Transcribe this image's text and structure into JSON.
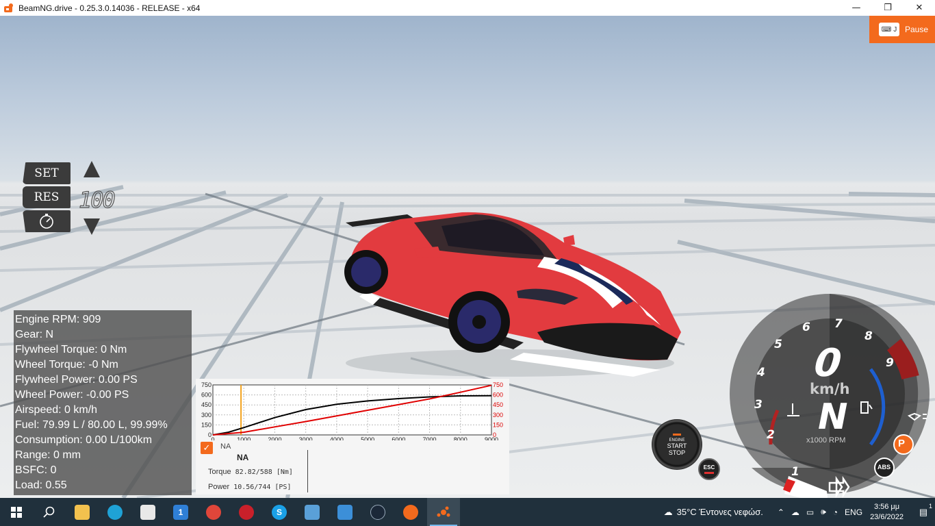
{
  "window": {
    "title": "BeamNG.drive - 0.25.3.0.14036 - RELEASE - x64",
    "minimize": "—",
    "restore": "❐",
    "close": "✕"
  },
  "pause": {
    "key": "J",
    "label": "Pause"
  },
  "cruise": {
    "set": "SET",
    "res": "RES",
    "speed": "100"
  },
  "stats": {
    "lines": [
      "Engine RPM: 909",
      "Gear: N",
      "Flywheel Torque: 0 Nm",
      "Wheel Torque: -0 Nm",
      "Flywheel Power: 0.00 PS",
      "Wheel Power: -0.00 PS",
      "Airspeed: 0 km/h",
      "Fuel: 79.99 L / 80.00 L, 99.99%",
      "Consumption: 0.00 L/100km",
      "Range: 0 mm",
      "BSFC: 0",
      "Load: 0.55"
    ]
  },
  "graph": {
    "checkbox_label": "NA",
    "table_head": "NA",
    "torque_label": "Torque",
    "torque_value": "82.82/588 [Nm]",
    "power_label": "Power",
    "power_value": "10.56/744 [PS]"
  },
  "chart_data": {
    "type": "line",
    "x_ticks": [
      0,
      1000,
      2000,
      3000,
      4000,
      5000,
      6000,
      7000,
      8000,
      9000
    ],
    "y_left_ticks": [
      0,
      150,
      300,
      450,
      600,
      750
    ],
    "y_right_ticks": [
      0,
      150,
      300,
      450,
      600,
      750
    ],
    "xlim": [
      0,
      9000
    ],
    "ylim": [
      0,
      750
    ],
    "current_rpm": 909,
    "series": [
      {
        "color": "#000000",
        "x": [
          0,
          500,
          1000,
          2000,
          3000,
          4000,
          5000,
          6000,
          7000,
          8000,
          9000
        ],
        "values": [
          0,
          40,
          110,
          260,
          380,
          460,
          510,
          545,
          570,
          585,
          588
        ]
      },
      {
        "color": "#e00000",
        "x": [
          0,
          1000,
          2000,
          3000,
          4000,
          5000,
          6000,
          7000,
          8000,
          9000
        ],
        "values": [
          0,
          40,
          120,
          200,
          285,
          370,
          455,
          540,
          640,
          744
        ]
      }
    ],
    "grid": true
  },
  "engine": {
    "line1": "ENGINE",
    "line2": "START",
    "line3": "STOP",
    "esc": "ESC"
  },
  "gauge": {
    "speed": "0",
    "unit": "km/h",
    "gear": "N",
    "rpm_label": "x1000 RPM",
    "numbers": [
      "1",
      "2",
      "3",
      "4",
      "5",
      "6",
      "7",
      "8",
      "9"
    ],
    "parking": "P",
    "abs": "ABS"
  },
  "taskbar": {
    "weather": "35°C  Έντονες νεφώσ.",
    "lang": "ENG",
    "time": "3:56 μμ",
    "date": "23/6/2022",
    "notification_count": "1",
    "mail_badge": "1"
  },
  "colors": {
    "accent": "#f36a1d",
    "taskbar": "#20303c"
  }
}
